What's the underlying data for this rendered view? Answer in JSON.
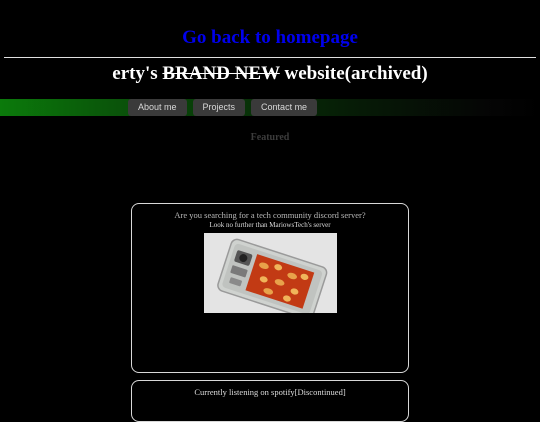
{
  "header": {
    "home_link": "Go back to homepage",
    "title_prefix": "erty's",
    "title_strike": "BRAND NEW",
    "title_suffix": "website(archived)"
  },
  "nav": {
    "items": [
      {
        "label": "About me"
      },
      {
        "label": "Projects"
      },
      {
        "label": "Contact me"
      }
    ]
  },
  "main": {
    "featured_heading": "Featured",
    "cards": [
      {
        "title": "Are you searching for a tech community discord server?",
        "subtitle": "Look no further than MariowsTech's server",
        "image_icon": "phone-back-photo"
      },
      {
        "title": "Currently listening on spotify[Discontinued]"
      }
    ]
  },
  "colors": {
    "background": "#000000",
    "link": "#0000ee",
    "nav_green": "#0b7a0b",
    "nav_button": "#3a3a3a",
    "card_border": "#d8d8d8"
  }
}
